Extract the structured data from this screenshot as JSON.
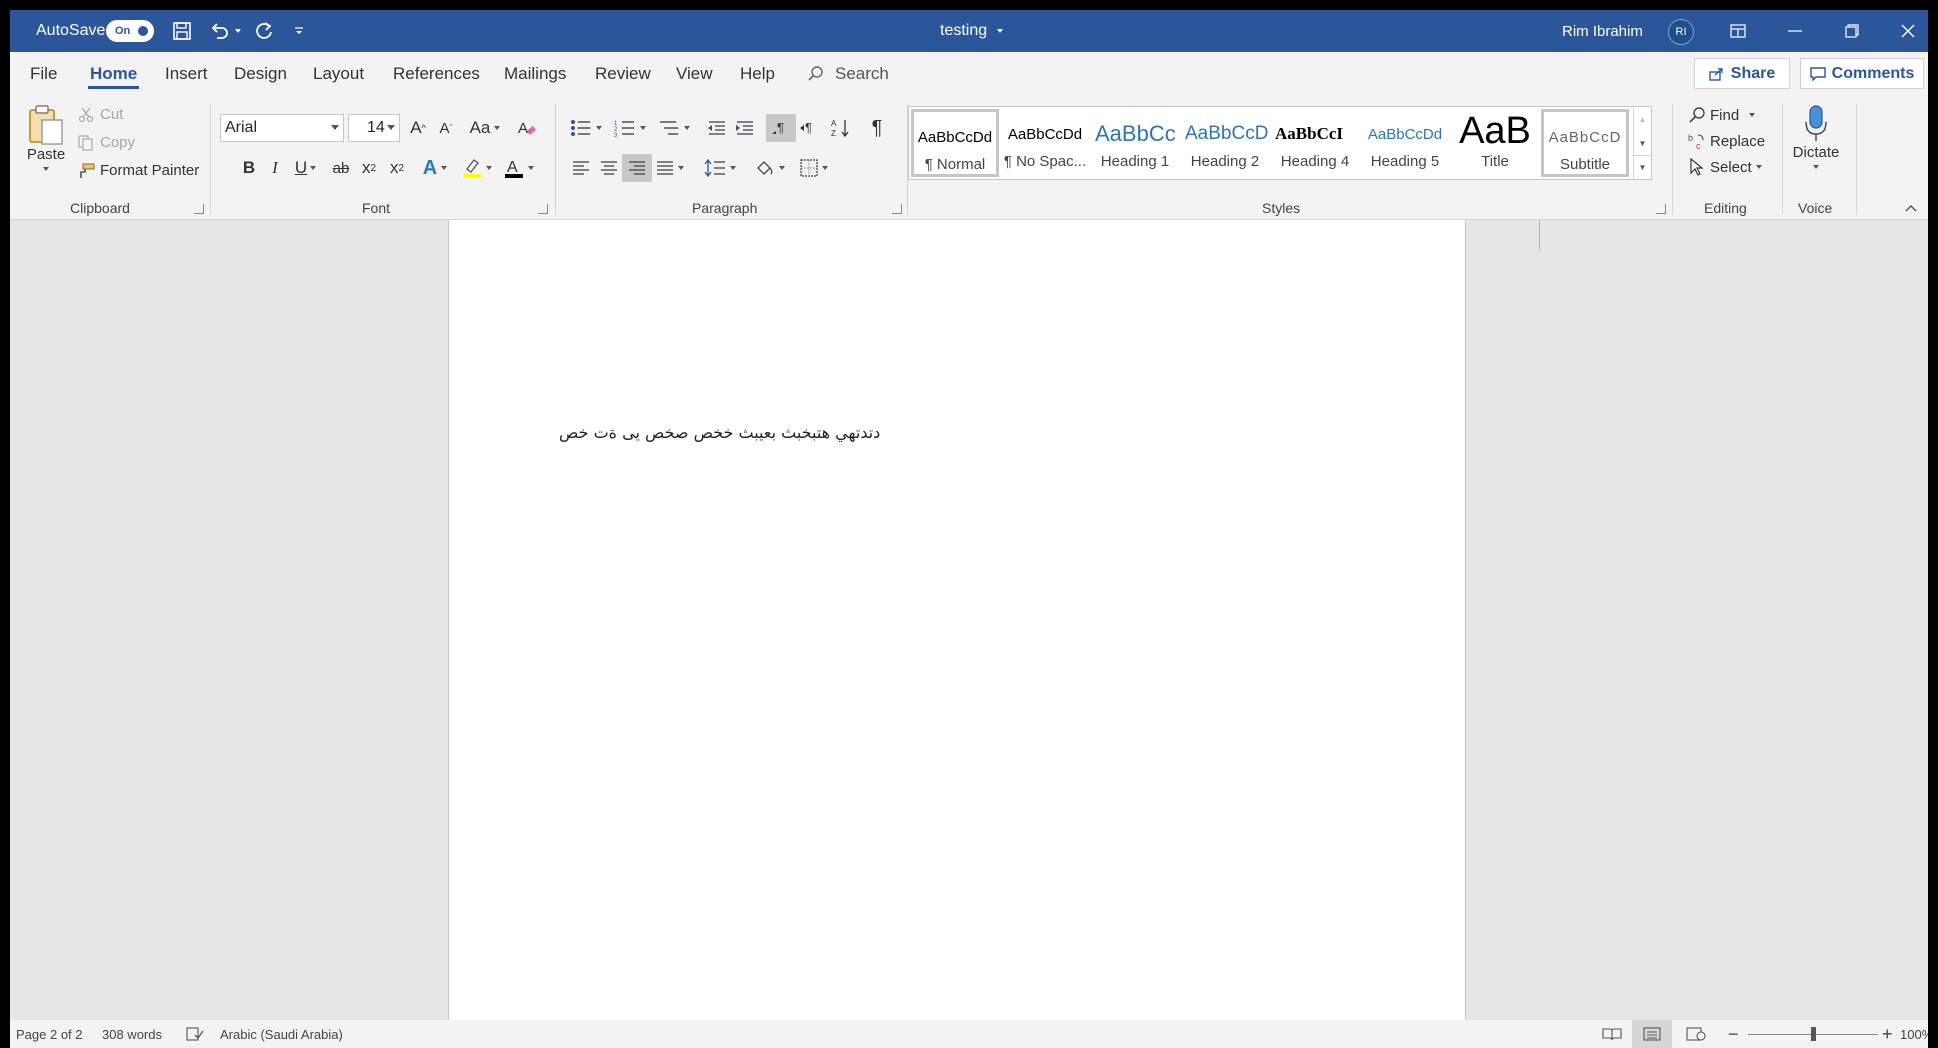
{
  "titlebar": {
    "autosave_label": "AutoSave",
    "autosave_state": "On",
    "doc_title": "testing",
    "user_name": "Rim Ibrahim",
    "user_initials": "RI"
  },
  "menu": {
    "tabs": [
      "File",
      "Home",
      "Insert",
      "Design",
      "Layout",
      "References",
      "Mailings",
      "Review",
      "View",
      "Help"
    ],
    "search_placeholder": "Search",
    "share": "Share",
    "comments": "Comments"
  },
  "clipboard": {
    "paste": "Paste",
    "cut": "Cut",
    "copy": "Copy",
    "format_painter": "Format Painter",
    "label": "Clipboard"
  },
  "font": {
    "name": "Arial",
    "size": "14",
    "grow": "A",
    "shrink": "A",
    "case": "Aa",
    "bold": "B",
    "italic": "I",
    "underline": "U",
    "strike": "ab",
    "sub": "x",
    "sup": "x",
    "sub_mark": "2",
    "sup_mark": "2",
    "effects": "A",
    "color": "A",
    "label": "Font"
  },
  "paragraph": {
    "label": "Paragraph"
  },
  "styles": {
    "label": "Styles",
    "items": [
      {
        "preview": "AaBbCcDd",
        "name": "¶ Normal"
      },
      {
        "preview": "AaBbCcDd",
        "name": "¶ No Spac..."
      },
      {
        "preview": "AaBbCc",
        "name": "Heading 1"
      },
      {
        "preview": "AaBbCcD",
        "name": "Heading 2"
      },
      {
        "preview": "AaBbCcI",
        "name": "Heading 4"
      },
      {
        "preview": "AaBbCcDd",
        "name": "Heading 5"
      },
      {
        "preview": "AaB",
        "name": "Title"
      },
      {
        "preview": "AaBbCcD",
        "name": "Subtitle"
      }
    ]
  },
  "editing": {
    "find": "Find",
    "replace": "Replace",
    "select": "Select",
    "label": "Editing"
  },
  "voice": {
    "dictate": "Dictate",
    "label": "Voice"
  },
  "document": {
    "text": "دتدتهي هتبخبث بعيبث خخص صخص يى ةت خص"
  },
  "status": {
    "page": "Page 2 of 2",
    "words": "308 words",
    "language": "Arabic (Saudi Arabia)",
    "zoom": "100%",
    "zoom_level": 0.5
  },
  "colors": {
    "accent": "#2b579a",
    "highlight": "#ffff00",
    "font_color": "#c00000"
  }
}
